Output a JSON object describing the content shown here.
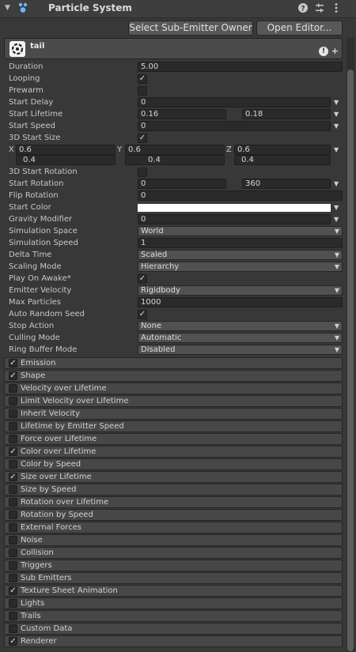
{
  "header": {
    "title": "Particle System",
    "icons": [
      "fold-arrow-icon",
      "particle-system-icon",
      "help-icon",
      "preset-icon",
      "more-icon"
    ]
  },
  "buttons": {
    "select_sub_emitter": "Select Sub-Emitter Owner",
    "open_editor": "Open Editor..."
  },
  "system": {
    "name": "tail"
  },
  "main": {
    "duration": {
      "label": "Duration",
      "value": "5.00"
    },
    "looping": {
      "label": "Looping",
      "checked": true
    },
    "prewarm": {
      "label": "Prewarm",
      "checked": false
    },
    "start_delay": {
      "label": "Start Delay",
      "value": "0"
    },
    "start_lifetime": {
      "label": "Start Lifetime",
      "min": "0.16",
      "max": "0.18"
    },
    "start_speed": {
      "label": "Start Speed",
      "value": "0"
    },
    "start_size_3d": {
      "label": "3D Start Size",
      "checked": true
    },
    "start_size": {
      "x_label": "X",
      "y_label": "Y",
      "z_label": "Z",
      "x1": "0.6",
      "y1": "0.6",
      "z1": "0.6",
      "x2": "0.4",
      "y2": "0.4",
      "z2": "0.4"
    },
    "start_rotation_3d": {
      "label": "3D Start Rotation",
      "checked": false
    },
    "start_rotation": {
      "label": "Start Rotation",
      "min": "0",
      "max": "360"
    },
    "flip_rotation": {
      "label": "Flip Rotation",
      "value": "0"
    },
    "start_color": {
      "label": "Start Color",
      "color": "#ffffff"
    },
    "gravity_modifier": {
      "label": "Gravity Modifier",
      "value": "0"
    },
    "simulation_space": {
      "label": "Simulation Space",
      "value": "World"
    },
    "simulation_speed": {
      "label": "Simulation Speed",
      "value": "1"
    },
    "delta_time": {
      "label": "Delta Time",
      "value": "Scaled"
    },
    "scaling_mode": {
      "label": "Scaling Mode",
      "value": "Hierarchy"
    },
    "play_on_awake": {
      "label": "Play On Awake*",
      "checked": true
    },
    "emitter_velocity": {
      "label": "Emitter Velocity",
      "value": "Rigidbody"
    },
    "max_particles": {
      "label": "Max Particles",
      "value": "1000"
    },
    "auto_random_seed": {
      "label": "Auto Random Seed",
      "checked": true
    },
    "stop_action": {
      "label": "Stop Action",
      "value": "None"
    },
    "culling_mode": {
      "label": "Culling Mode",
      "value": "Automatic"
    },
    "ring_buffer_mode": {
      "label": "Ring Buffer Mode",
      "value": "Disabled"
    }
  },
  "modules": [
    {
      "label": "Emission",
      "enabled": true
    },
    {
      "label": "Shape",
      "enabled": true
    },
    {
      "label": "Velocity over Lifetime",
      "enabled": false
    },
    {
      "label": "Limit Velocity over Lifetime",
      "enabled": false
    },
    {
      "label": "Inherit Velocity",
      "enabled": false
    },
    {
      "label": "Lifetime by Emitter Speed",
      "enabled": false
    },
    {
      "label": "Force over Lifetime",
      "enabled": false
    },
    {
      "label": "Color over Lifetime",
      "enabled": true
    },
    {
      "label": "Color by Speed",
      "enabled": false
    },
    {
      "label": "Size over Lifetime",
      "enabled": true
    },
    {
      "label": "Size by Speed",
      "enabled": false
    },
    {
      "label": "Rotation over Lifetime",
      "enabled": false
    },
    {
      "label": "Rotation by Speed",
      "enabled": false
    },
    {
      "label": "External Forces",
      "enabled": false
    },
    {
      "label": "Noise",
      "enabled": false
    },
    {
      "label": "Collision",
      "enabled": false
    },
    {
      "label": "Triggers",
      "enabled": false
    },
    {
      "label": "Sub Emitters",
      "enabled": false
    },
    {
      "label": "Texture Sheet Animation",
      "enabled": true
    },
    {
      "label": "Lights",
      "enabled": false
    },
    {
      "label": "Trails",
      "enabled": false
    },
    {
      "label": "Custom Data",
      "enabled": false
    },
    {
      "label": "Renderer",
      "enabled": true
    }
  ],
  "glyphs": {
    "check": "✓",
    "dropdown": "▼",
    "fold": "▼"
  }
}
